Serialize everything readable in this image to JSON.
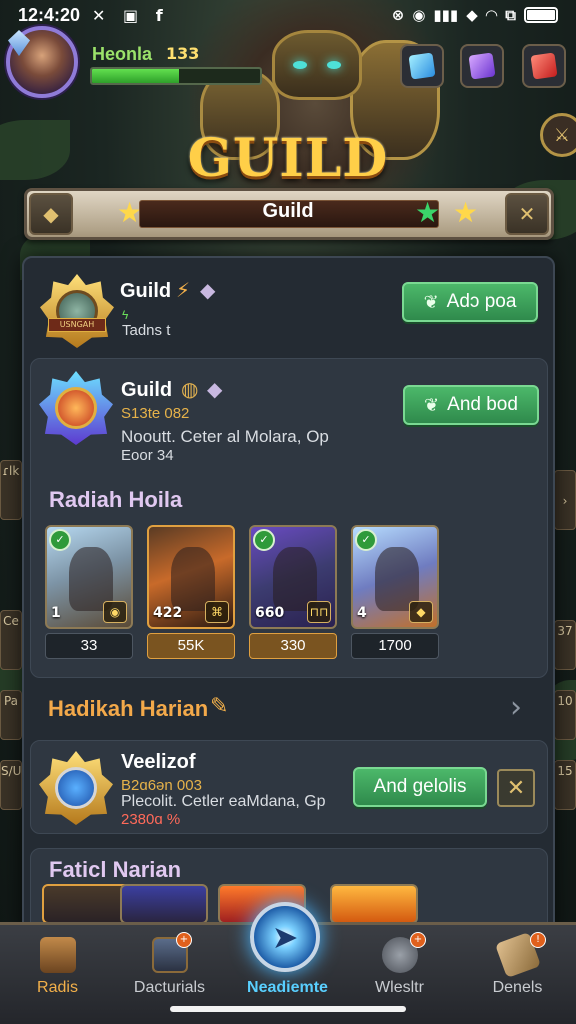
{
  "status_bar": {
    "time": "12:4:20",
    "left_icons": [
      "x-icon",
      "a-icon",
      "f-icon"
    ],
    "right_icons": [
      "nfc-icon",
      "circle-icon",
      "signal-icon",
      "location-icon",
      "wifi-icon",
      "data-icon",
      "battery-icon"
    ],
    "left_glyphs": "✕ ▣ f",
    "right_glyphs": [
      "⊗",
      "◉",
      "▮▮▮",
      "◆",
      "◠",
      "⧉"
    ]
  },
  "player": {
    "name": "Heonla",
    "level": "133",
    "xp_fraction": 0.52
  },
  "hud_buttons": [
    "blue-gem-cube-icon",
    "purple-gem-cube-icon",
    "red-gem-cube-icon"
  ],
  "title": "GUILD",
  "banner": {
    "label": "Guild",
    "left_button_icon": "shield-icon",
    "right_button_icon": "close-icon",
    "left_glyph": "◆",
    "right_glyph": "✕"
  },
  "guild_card_1": {
    "name": "Guild",
    "small_tag": "ϟ",
    "subtitle": "Tadns t",
    "emblem_ribbon": "USNGAH",
    "button_label": "Adɔ poa"
  },
  "guild_card_2": {
    "name": "Guild",
    "line1": "S13te 082",
    "line2": "Nooutt. Ceter al Molara, Op",
    "line3": "Eoor 34",
    "button_label": "And bod",
    "section_title": "Radiah Hoila",
    "heroes": [
      {
        "level": "1",
        "value": "33",
        "tag": "◉"
      },
      {
        "level": "422",
        "value": "55K",
        "tag": "⌘"
      },
      {
        "level": "660",
        "value": "330",
        "tag": "⊓⊓"
      },
      {
        "level": "4",
        "value": "1700",
        "tag": "◆"
      }
    ]
  },
  "section_2_title": "Hadikah Harian",
  "guild_card_3": {
    "name": "Veelizof",
    "line1": "B2ɑ6ən 003",
    "line2": "Plecolit. Cetler eaMdana, Gp",
    "line3": "2380ɑ %",
    "button_label": "And gelolis",
    "close_glyph": "✕"
  },
  "section_3_title": "Faticl Narian",
  "bottom_nav": {
    "items": [
      {
        "label": "Radis",
        "icon": "treasure-chest-icon"
      },
      {
        "label": "Dacturials",
        "icon": "box-icon"
      },
      {
        "label": "Neadiemte",
        "icon": "cursor-orb-icon"
      },
      {
        "label": "Wlesltr",
        "icon": "gear-icon"
      },
      {
        "label": "Denels",
        "icon": "scroll-icon"
      }
    ],
    "center_glyph": "➤"
  },
  "side_labels": {
    "left": [
      "ɾlk",
      "Ce",
      "Pa",
      "S/U"
    ],
    "right": [
      "37",
      "10",
      "15"
    ]
  },
  "colors": {
    "accent_green": "#4cb86a",
    "title_gold": "#ffcf48",
    "panel_bg": "#242b33",
    "nav_active_blue": "#5ad0ff",
    "nav_active_orange": "#f3b04a"
  }
}
